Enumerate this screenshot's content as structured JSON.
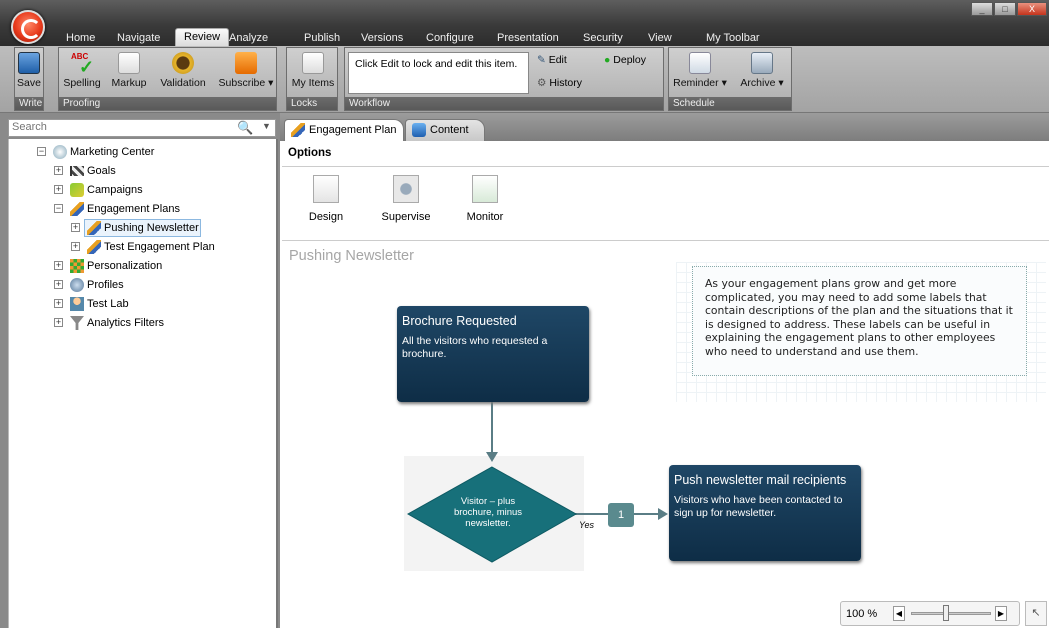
{
  "window": {
    "min": "_",
    "max": "□",
    "close": "X"
  },
  "menu": [
    "Home",
    "Navigate",
    "Review",
    "Analyze",
    "Publish",
    "Versions",
    "Configure",
    "Presentation",
    "Security",
    "View",
    "My Toolbar"
  ],
  "menu_active": "Review",
  "ribbon": {
    "save": "Save",
    "write": "Write",
    "spelling": "Spelling",
    "markup": "Markup",
    "validation": "Validation",
    "subscribe": "Subscribe",
    "proofing": "Proofing",
    "myitems": "My Items",
    "locks": "Locks",
    "workflow_msg": "Click Edit to lock and edit this item.",
    "edit": "Edit",
    "deploy": "Deploy",
    "history": "History",
    "workflow": "Workflow",
    "reminder": "Reminder",
    "archive": "Archive",
    "schedule": "Schedule",
    "abc": "ABC"
  },
  "search": {
    "placeholder": "Search"
  },
  "tree": {
    "root": "Marketing Center",
    "items": [
      "Goals",
      "Campaigns",
      "Engagement Plans",
      "Pushing Newsletter",
      "Test Engagement Plan",
      "Personalization",
      "Profiles",
      "Test Lab",
      "Analytics Filters"
    ]
  },
  "tabs": [
    "Engagement Plan",
    "Content"
  ],
  "options": {
    "title": "Options",
    "design": "Design",
    "supervise": "Supervise",
    "monitor": "Monitor"
  },
  "plan": {
    "title": "Pushing Newsletter",
    "note": "As your engagement plans grow and get more complicated, you may need to add some labels that contain descriptions of the plan and the situations that it is designed to address. These labels can be useful in explaining the engagement plans to other employees who need to understand and use them.",
    "state1_title": "Brochure Requested",
    "state1_desc": "All the visitors who requested a brochure.",
    "cond": "Visitor – plus brochure, minus newsletter.",
    "yes": "Yes",
    "step": "1",
    "state2_title": "Push newsletter mail recipients",
    "state2_desc": "Visitors who have been contacted to sign up for newsletter."
  },
  "zoom": {
    "value": "100 %"
  },
  "colors": {
    "card": "#0e2d46",
    "diamond": "#17707a",
    "connector": "#5a7d85"
  }
}
